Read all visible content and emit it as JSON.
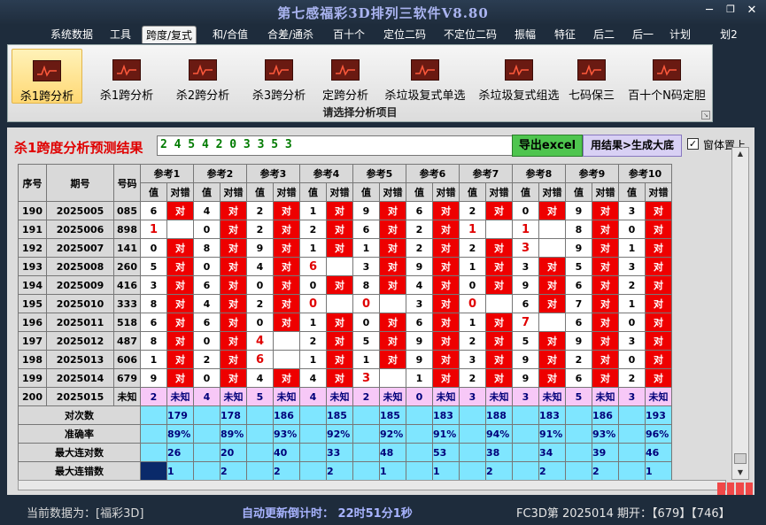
{
  "window": {
    "title": "第七感福彩3D排列三软件V8.80"
  },
  "menu": [
    "系统数据",
    "工具",
    "跨度/复式",
    "和/合值",
    "合差/通杀",
    "百十个",
    "定位二码",
    "不定位二码",
    "振幅",
    "特征",
    "后二",
    "后一",
    "计划",
    "划2"
  ],
  "menu_active": 2,
  "ribbon": {
    "buttons": [
      "杀1跨分析",
      "杀1跨分析",
      "杀2跨分析",
      "杀3跨分析",
      "定跨分析",
      "杀垃圾复式单选",
      "杀垃圾复式组选",
      "七码保三",
      "百十个N码定胆"
    ],
    "active": 0,
    "caption": "请选择分析项目"
  },
  "result": {
    "label": "杀1跨度分析预测结果",
    "value": "2 4 5 4 2 0 3 3 5 3",
    "excel_button": "导出excel",
    "generate_button": "用结果>生成大底",
    "on_top_label": "窗体置上",
    "on_top_checked": "✓"
  },
  "table": {
    "headers": {
      "seq": "序号",
      "issue": "期号",
      "number": "号码",
      "refs": [
        "参考1",
        "参考2",
        "参考3",
        "参考4",
        "参考5",
        "参考6",
        "参考7",
        "参考8",
        "参考9",
        "参考10"
      ],
      "value": "值",
      "check": "对错"
    },
    "rows": [
      {
        "seq": "190",
        "issue": "2025005",
        "num": "085",
        "cells": [
          [
            "6",
            "对"
          ],
          [
            "4",
            "对"
          ],
          [
            "2",
            "对"
          ],
          [
            "1",
            "对"
          ],
          [
            "9",
            "对"
          ],
          [
            "6",
            "对"
          ],
          [
            "2",
            "对"
          ],
          [
            "0",
            "对"
          ],
          [
            "9",
            "对"
          ],
          [
            "3",
            "对"
          ]
        ]
      },
      {
        "seq": "191",
        "issue": "2025006",
        "num": "898",
        "cells": [
          [
            "1",
            ""
          ],
          [
            "0",
            "对"
          ],
          [
            "2",
            "对"
          ],
          [
            "2",
            "对"
          ],
          [
            "6",
            "对"
          ],
          [
            "2",
            "对"
          ],
          [
            "1",
            ""
          ],
          [
            "1",
            ""
          ],
          [
            "8",
            "对"
          ],
          [
            "0",
            "对"
          ]
        ]
      },
      {
        "seq": "192",
        "issue": "2025007",
        "num": "141",
        "cells": [
          [
            "0",
            "对"
          ],
          [
            "8",
            "对"
          ],
          [
            "9",
            "对"
          ],
          [
            "1",
            "对"
          ],
          [
            "1",
            "对"
          ],
          [
            "2",
            "对"
          ],
          [
            "2",
            "对"
          ],
          [
            "3",
            ""
          ],
          [
            "9",
            "对"
          ],
          [
            "1",
            "对"
          ]
        ]
      },
      {
        "seq": "193",
        "issue": "2025008",
        "num": "260",
        "cells": [
          [
            "5",
            "对"
          ],
          [
            "0",
            "对"
          ],
          [
            "4",
            "对"
          ],
          [
            "6",
            ""
          ],
          [
            "3",
            "对"
          ],
          [
            "9",
            "对"
          ],
          [
            "1",
            "对"
          ],
          [
            "3",
            "对"
          ],
          [
            "5",
            "对"
          ],
          [
            "3",
            "对"
          ]
        ]
      },
      {
        "seq": "194",
        "issue": "2025009",
        "num": "416",
        "cells": [
          [
            "3",
            "对"
          ],
          [
            "6",
            "对"
          ],
          [
            "0",
            "对"
          ],
          [
            "0",
            "对"
          ],
          [
            "8",
            "对"
          ],
          [
            "4",
            "对"
          ],
          [
            "0",
            "对"
          ],
          [
            "9",
            "对"
          ],
          [
            "6",
            "对"
          ],
          [
            "2",
            "对"
          ]
        ]
      },
      {
        "seq": "195",
        "issue": "2025010",
        "num": "333",
        "cells": [
          [
            "8",
            "对"
          ],
          [
            "4",
            "对"
          ],
          [
            "2",
            "对"
          ],
          [
            "0",
            ""
          ],
          [
            "0",
            ""
          ],
          [
            "3",
            "对"
          ],
          [
            "0",
            ""
          ],
          [
            "6",
            "对"
          ],
          [
            "7",
            "对"
          ],
          [
            "1",
            "对"
          ]
        ]
      },
      {
        "seq": "196",
        "issue": "2025011",
        "num": "518",
        "cells": [
          [
            "6",
            "对"
          ],
          [
            "6",
            "对"
          ],
          [
            "0",
            "对"
          ],
          [
            "1",
            "对"
          ],
          [
            "0",
            "对"
          ],
          [
            "6",
            "对"
          ],
          [
            "1",
            "对"
          ],
          [
            "7",
            ""
          ],
          [
            "6",
            "对"
          ],
          [
            "0",
            "对"
          ]
        ]
      },
      {
        "seq": "197",
        "issue": "2025012",
        "num": "487",
        "cells": [
          [
            "8",
            "对"
          ],
          [
            "0",
            "对"
          ],
          [
            "4",
            ""
          ],
          [
            "2",
            "对"
          ],
          [
            "5",
            "对"
          ],
          [
            "9",
            "对"
          ],
          [
            "2",
            "对"
          ],
          [
            "5",
            "对"
          ],
          [
            "9",
            "对"
          ],
          [
            "3",
            "对"
          ]
        ]
      },
      {
        "seq": "198",
        "issue": "2025013",
        "num": "606",
        "cells": [
          [
            "1",
            "对"
          ],
          [
            "2",
            "对"
          ],
          [
            "6",
            ""
          ],
          [
            "1",
            "对"
          ],
          [
            "1",
            "对"
          ],
          [
            "9",
            "对"
          ],
          [
            "3",
            "对"
          ],
          [
            "9",
            "对"
          ],
          [
            "2",
            "对"
          ],
          [
            "0",
            "对"
          ]
        ]
      },
      {
        "seq": "199",
        "issue": "2025014",
        "num": "679",
        "cells": [
          [
            "9",
            "对"
          ],
          [
            "0",
            "对"
          ],
          [
            "4",
            "对"
          ],
          [
            "4",
            "对"
          ],
          [
            "3",
            ""
          ],
          [
            "1",
            "对"
          ],
          [
            "2",
            "对"
          ],
          [
            "9",
            "对"
          ],
          [
            "6",
            "对"
          ],
          [
            "2",
            "对"
          ]
        ]
      }
    ],
    "highlight": [
      [
        1,
        0
      ],
      [
        1,
        6
      ],
      [
        1,
        7
      ],
      [
        2,
        7
      ],
      [
        3,
        3
      ],
      [
        5,
        3
      ],
      [
        5,
        4
      ],
      [
        5,
        6
      ],
      [
        6,
        7
      ],
      [
        7,
        2
      ],
      [
        8,
        2
      ],
      [
        9,
        4
      ]
    ],
    "prediction": {
      "seq": "200",
      "issue": "2025015",
      "num": "未知",
      "values": [
        "2",
        "4",
        "5",
        "4",
        "2",
        "0",
        "3",
        "3",
        "5",
        "3"
      ],
      "check": "未知"
    },
    "stats": [
      {
        "label": "对次数",
        "values": [
          "179",
          "178",
          "186",
          "185",
          "185",
          "183",
          "188",
          "183",
          "186",
          "193"
        ]
      },
      {
        "label": "准确率",
        "values": [
          "89%",
          "89%",
          "93%",
          "92%",
          "92%",
          "91%",
          "94%",
          "91%",
          "93%",
          "96%"
        ]
      },
      {
        "label": "最大连对数",
        "values": [
          "26",
          "20",
          "40",
          "33",
          "48",
          "53",
          "38",
          "34",
          "39",
          "46"
        ]
      },
      {
        "label": "最大连错数",
        "values": [
          "1",
          "2",
          "2",
          "2",
          "1",
          "1",
          "2",
          "2",
          "2",
          "1"
        ]
      }
    ]
  },
  "status": {
    "current_data": "当前数据为：[福彩3D]",
    "countdown": "自动更新倒计时：  22时51分1秒",
    "issue_info": "FC3D第 2025014 期开：【679】【746】"
  },
  "colors": {
    "hit": "#ee0000",
    "prediction": "#f7c8f7",
    "stats": "#7fe6ff",
    "excel": "#4ec54e"
  }
}
